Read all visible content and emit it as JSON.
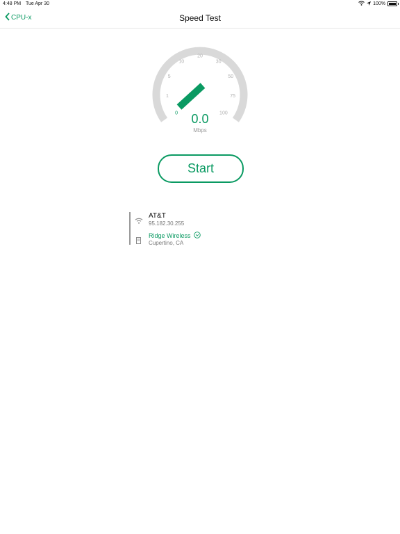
{
  "status": {
    "time": "4:48 PM",
    "date": "Tue Apr 30",
    "battery": "100%"
  },
  "nav": {
    "back_label": "CPU-x",
    "title": "Speed Test"
  },
  "gauge": {
    "ticks": [
      "0",
      "1",
      "5",
      "10",
      "20",
      "30",
      "50",
      "75",
      "100"
    ],
    "value": "0.0",
    "unit": "Mbps",
    "colors": {
      "track": "#d9d9d9",
      "needle": "#0a9a62",
      "tick_text": "#b0b0b0"
    }
  },
  "start_label": "Start",
  "connection": {
    "isp_name": "AT&T",
    "ip": "95.182.30.255",
    "server_name": "Ridge Wireless",
    "server_location": "Cupertino, CA"
  },
  "colors": {
    "accent": "#0a9a62"
  }
}
